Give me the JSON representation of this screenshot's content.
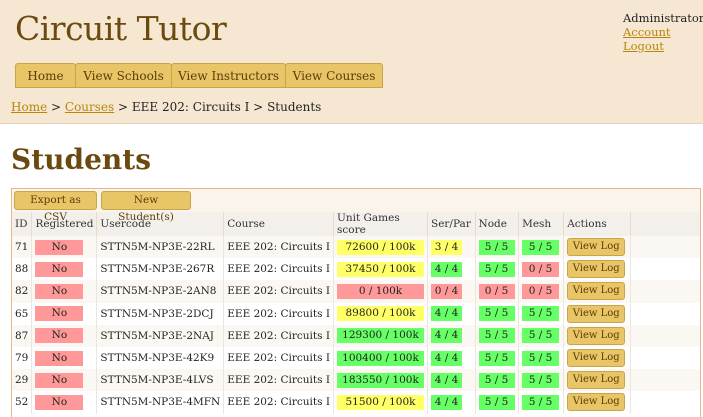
{
  "header": {
    "app_title": "Circuit Tutor",
    "user": {
      "name": "Administrator",
      "account_link": "Account",
      "logout_link": "Logout"
    },
    "nav": [
      {
        "label": "Home"
      },
      {
        "label": "View Schools"
      },
      {
        "label": "View Instructors"
      },
      {
        "label": "View Courses"
      }
    ]
  },
  "breadcrumb": {
    "home": "Home",
    "sep1": ">",
    "courses": "Courses",
    "sep2": ">",
    "course": "EEE 202: Circuits I",
    "sep3": ">",
    "current": "Students"
  },
  "main": {
    "title": "Students",
    "toolbar": {
      "export_label": "Export as CSV",
      "new_label": "New Student(s)"
    },
    "table": {
      "columns": [
        "ID",
        "Registered",
        "Usercode",
        "Course",
        "Unit Games score",
        "Ser/Par",
        "Node",
        "Mesh",
        "Actions"
      ],
      "rows": [
        {
          "id": "71",
          "registered": "No",
          "usercode": "STTN5M-NP3E-22RL",
          "course": "EEE 202: Circuits I",
          "score": "72600 / 100k",
          "score_status": "yellow",
          "serpar": "3 / 4",
          "serpar_status": "yellow",
          "node": "5 / 5",
          "node_status": "green",
          "mesh": "5 / 5",
          "mesh_status": "green",
          "action": "View Log"
        },
        {
          "id": "88",
          "registered": "No",
          "usercode": "STTN5M-NP3E-267R",
          "course": "EEE 202: Circuits I",
          "score": "37450 / 100k",
          "score_status": "yellow",
          "serpar": "4 / 4",
          "serpar_status": "green",
          "node": "5 / 5",
          "node_status": "green",
          "mesh": "0 / 5",
          "mesh_status": "red",
          "action": "View Log"
        },
        {
          "id": "82",
          "registered": "No",
          "usercode": "STTN5M-NP3E-2AN8",
          "course": "EEE 202: Circuits I",
          "score": "0 / 100k",
          "score_status": "red",
          "serpar": "0 / 4",
          "serpar_status": "red",
          "node": "0 / 5",
          "node_status": "red",
          "mesh": "0 / 5",
          "mesh_status": "red",
          "action": "View Log"
        },
        {
          "id": "65",
          "registered": "No",
          "usercode": "STTN5M-NP3E-2DCJ",
          "course": "EEE 202: Circuits I",
          "score": "89800 / 100k",
          "score_status": "yellow",
          "serpar": "4 / 4",
          "serpar_status": "green",
          "node": "5 / 5",
          "node_status": "green",
          "mesh": "5 / 5",
          "mesh_status": "green",
          "action": "View Log"
        },
        {
          "id": "87",
          "registered": "No",
          "usercode": "STTN5M-NP3E-2NAJ",
          "course": "EEE 202: Circuits I",
          "score": "129300 / 100k",
          "score_status": "green",
          "serpar": "4 / 4",
          "serpar_status": "green",
          "node": "5 / 5",
          "node_status": "green",
          "mesh": "5 / 5",
          "mesh_status": "green",
          "action": "View Log"
        },
        {
          "id": "79",
          "registered": "No",
          "usercode": "STTN5M-NP3E-42K9",
          "course": "EEE 202: Circuits I",
          "score": "100400 / 100k",
          "score_status": "green",
          "serpar": "4 / 4",
          "serpar_status": "green",
          "node": "5 / 5",
          "node_status": "green",
          "mesh": "5 / 5",
          "mesh_status": "green",
          "action": "View Log"
        },
        {
          "id": "29",
          "registered": "No",
          "usercode": "STTN5M-NP3E-4LVS",
          "course": "EEE 202: Circuits I",
          "score": "183550 / 100k",
          "score_status": "green",
          "serpar": "4 / 4",
          "serpar_status": "green",
          "node": "5 / 5",
          "node_status": "green",
          "mesh": "5 / 5",
          "mesh_status": "green",
          "action": "View Log"
        },
        {
          "id": "52",
          "registered": "No",
          "usercode": "STTN5M-NP3E-4MFN",
          "course": "EEE 202: Circuits I",
          "score": "51500 / 100k",
          "score_status": "yellow",
          "serpar": "4 / 4",
          "serpar_status": "green",
          "node": "5 / 5",
          "node_status": "green",
          "mesh": "5 / 5",
          "mesh_status": "green",
          "action": "View Log"
        }
      ]
    }
  },
  "colors": {
    "header_bg": "#f6e7d3",
    "brand_text": "#6b4a0f",
    "button_bg": "#e8c566",
    "link": "#b8860b",
    "status_red": "#ff9999",
    "status_yellow": "#ffff66",
    "status_green": "#66ff66"
  }
}
